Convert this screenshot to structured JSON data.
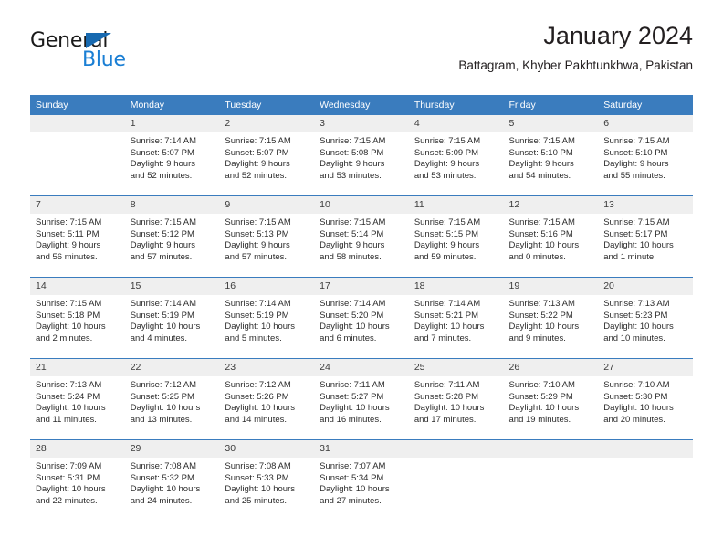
{
  "brand": {
    "name_top": "General",
    "name_bottom": "Blue",
    "color_dark": "#1a1a1a",
    "color_blue": "#1b7fd4",
    "triangle_color": "#1769b0"
  },
  "header": {
    "title": "January 2024",
    "subtitle": "Battagram, Khyber Pakhtunkhwa, Pakistan"
  },
  "theme": {
    "header_row_bg": "#3a7cbe",
    "header_row_text": "#ffffff",
    "daynum_bg": "#efefef",
    "row_divider": "#3a7cbe",
    "page_bg": "#ffffff",
    "body_text": "#2b2b2b"
  },
  "weekday_headers": [
    "Sunday",
    "Monday",
    "Tuesday",
    "Wednesday",
    "Thursday",
    "Friday",
    "Saturday"
  ],
  "weeks": [
    [
      {
        "day": "",
        "blank": true,
        "sunrise": "",
        "sunset": "",
        "daylight_line1": "",
        "daylight_line2": ""
      },
      {
        "day": "1",
        "sunrise": "Sunrise: 7:14 AM",
        "sunset": "Sunset: 5:07 PM",
        "daylight_line1": "Daylight: 9 hours",
        "daylight_line2": "and 52 minutes."
      },
      {
        "day": "2",
        "sunrise": "Sunrise: 7:15 AM",
        "sunset": "Sunset: 5:07 PM",
        "daylight_line1": "Daylight: 9 hours",
        "daylight_line2": "and 52 minutes."
      },
      {
        "day": "3",
        "sunrise": "Sunrise: 7:15 AM",
        "sunset": "Sunset: 5:08 PM",
        "daylight_line1": "Daylight: 9 hours",
        "daylight_line2": "and 53 minutes."
      },
      {
        "day": "4",
        "sunrise": "Sunrise: 7:15 AM",
        "sunset": "Sunset: 5:09 PM",
        "daylight_line1": "Daylight: 9 hours",
        "daylight_line2": "and 53 minutes."
      },
      {
        "day": "5",
        "sunrise": "Sunrise: 7:15 AM",
        "sunset": "Sunset: 5:10 PM",
        "daylight_line1": "Daylight: 9 hours",
        "daylight_line2": "and 54 minutes."
      },
      {
        "day": "6",
        "sunrise": "Sunrise: 7:15 AM",
        "sunset": "Sunset: 5:10 PM",
        "daylight_line1": "Daylight: 9 hours",
        "daylight_line2": "and 55 minutes."
      }
    ],
    [
      {
        "day": "7",
        "sunrise": "Sunrise: 7:15 AM",
        "sunset": "Sunset: 5:11 PM",
        "daylight_line1": "Daylight: 9 hours",
        "daylight_line2": "and 56 minutes."
      },
      {
        "day": "8",
        "sunrise": "Sunrise: 7:15 AM",
        "sunset": "Sunset: 5:12 PM",
        "daylight_line1": "Daylight: 9 hours",
        "daylight_line2": "and 57 minutes."
      },
      {
        "day": "9",
        "sunrise": "Sunrise: 7:15 AM",
        "sunset": "Sunset: 5:13 PM",
        "daylight_line1": "Daylight: 9 hours",
        "daylight_line2": "and 57 minutes."
      },
      {
        "day": "10",
        "sunrise": "Sunrise: 7:15 AM",
        "sunset": "Sunset: 5:14 PM",
        "daylight_line1": "Daylight: 9 hours",
        "daylight_line2": "and 58 minutes."
      },
      {
        "day": "11",
        "sunrise": "Sunrise: 7:15 AM",
        "sunset": "Sunset: 5:15 PM",
        "daylight_line1": "Daylight: 9 hours",
        "daylight_line2": "and 59 minutes."
      },
      {
        "day": "12",
        "sunrise": "Sunrise: 7:15 AM",
        "sunset": "Sunset: 5:16 PM",
        "daylight_line1": "Daylight: 10 hours",
        "daylight_line2": "and 0 minutes."
      },
      {
        "day": "13",
        "sunrise": "Sunrise: 7:15 AM",
        "sunset": "Sunset: 5:17 PM",
        "daylight_line1": "Daylight: 10 hours",
        "daylight_line2": "and 1 minute."
      }
    ],
    [
      {
        "day": "14",
        "sunrise": "Sunrise: 7:15 AM",
        "sunset": "Sunset: 5:18 PM",
        "daylight_line1": "Daylight: 10 hours",
        "daylight_line2": "and 2 minutes."
      },
      {
        "day": "15",
        "sunrise": "Sunrise: 7:14 AM",
        "sunset": "Sunset: 5:19 PM",
        "daylight_line1": "Daylight: 10 hours",
        "daylight_line2": "and 4 minutes."
      },
      {
        "day": "16",
        "sunrise": "Sunrise: 7:14 AM",
        "sunset": "Sunset: 5:19 PM",
        "daylight_line1": "Daylight: 10 hours",
        "daylight_line2": "and 5 minutes."
      },
      {
        "day": "17",
        "sunrise": "Sunrise: 7:14 AM",
        "sunset": "Sunset: 5:20 PM",
        "daylight_line1": "Daylight: 10 hours",
        "daylight_line2": "and 6 minutes."
      },
      {
        "day": "18",
        "sunrise": "Sunrise: 7:14 AM",
        "sunset": "Sunset: 5:21 PM",
        "daylight_line1": "Daylight: 10 hours",
        "daylight_line2": "and 7 minutes."
      },
      {
        "day": "19",
        "sunrise": "Sunrise: 7:13 AM",
        "sunset": "Sunset: 5:22 PM",
        "daylight_line1": "Daylight: 10 hours",
        "daylight_line2": "and 9 minutes."
      },
      {
        "day": "20",
        "sunrise": "Sunrise: 7:13 AM",
        "sunset": "Sunset: 5:23 PM",
        "daylight_line1": "Daylight: 10 hours",
        "daylight_line2": "and 10 minutes."
      }
    ],
    [
      {
        "day": "21",
        "sunrise": "Sunrise: 7:13 AM",
        "sunset": "Sunset: 5:24 PM",
        "daylight_line1": "Daylight: 10 hours",
        "daylight_line2": "and 11 minutes."
      },
      {
        "day": "22",
        "sunrise": "Sunrise: 7:12 AM",
        "sunset": "Sunset: 5:25 PM",
        "daylight_line1": "Daylight: 10 hours",
        "daylight_line2": "and 13 minutes."
      },
      {
        "day": "23",
        "sunrise": "Sunrise: 7:12 AM",
        "sunset": "Sunset: 5:26 PM",
        "daylight_line1": "Daylight: 10 hours",
        "daylight_line2": "and 14 minutes."
      },
      {
        "day": "24",
        "sunrise": "Sunrise: 7:11 AM",
        "sunset": "Sunset: 5:27 PM",
        "daylight_line1": "Daylight: 10 hours",
        "daylight_line2": "and 16 minutes."
      },
      {
        "day": "25",
        "sunrise": "Sunrise: 7:11 AM",
        "sunset": "Sunset: 5:28 PM",
        "daylight_line1": "Daylight: 10 hours",
        "daylight_line2": "and 17 minutes."
      },
      {
        "day": "26",
        "sunrise": "Sunrise: 7:10 AM",
        "sunset": "Sunset: 5:29 PM",
        "daylight_line1": "Daylight: 10 hours",
        "daylight_line2": "and 19 minutes."
      },
      {
        "day": "27",
        "sunrise": "Sunrise: 7:10 AM",
        "sunset": "Sunset: 5:30 PM",
        "daylight_line1": "Daylight: 10 hours",
        "daylight_line2": "and 20 minutes."
      }
    ],
    [
      {
        "day": "28",
        "sunrise": "Sunrise: 7:09 AM",
        "sunset": "Sunset: 5:31 PM",
        "daylight_line1": "Daylight: 10 hours",
        "daylight_line2": "and 22 minutes."
      },
      {
        "day": "29",
        "sunrise": "Sunrise: 7:08 AM",
        "sunset": "Sunset: 5:32 PM",
        "daylight_line1": "Daylight: 10 hours",
        "daylight_line2": "and 24 minutes."
      },
      {
        "day": "30",
        "sunrise": "Sunrise: 7:08 AM",
        "sunset": "Sunset: 5:33 PM",
        "daylight_line1": "Daylight: 10 hours",
        "daylight_line2": "and 25 minutes."
      },
      {
        "day": "31",
        "sunrise": "Sunrise: 7:07 AM",
        "sunset": "Sunset: 5:34 PM",
        "daylight_line1": "Daylight: 10 hours",
        "daylight_line2": "and 27 minutes."
      },
      {
        "day": "",
        "blank": true,
        "sunrise": "",
        "sunset": "",
        "daylight_line1": "",
        "daylight_line2": ""
      },
      {
        "day": "",
        "blank": true,
        "sunrise": "",
        "sunset": "",
        "daylight_line1": "",
        "daylight_line2": ""
      },
      {
        "day": "",
        "blank": true,
        "sunrise": "",
        "sunset": "",
        "daylight_line1": "",
        "daylight_line2": ""
      }
    ]
  ]
}
